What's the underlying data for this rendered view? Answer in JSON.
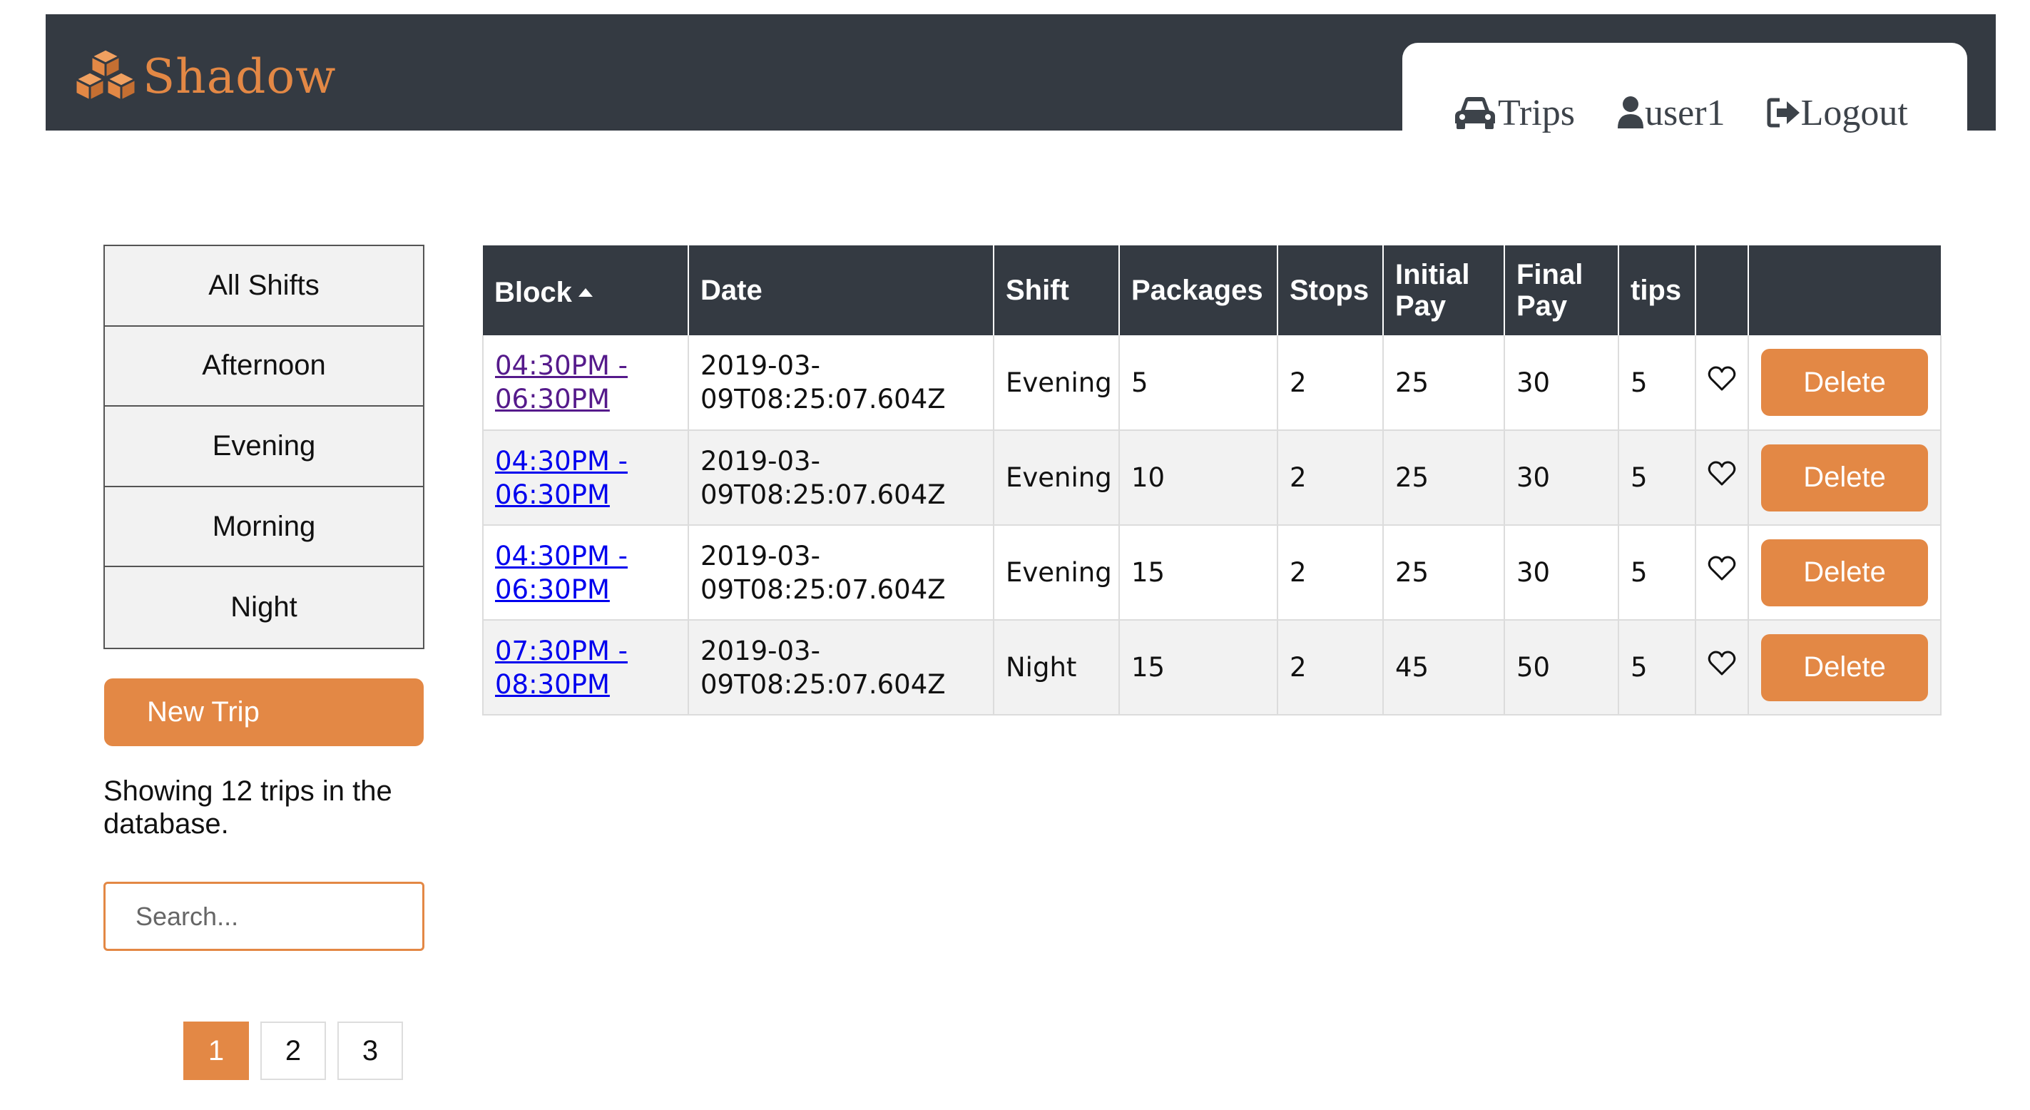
{
  "header": {
    "brand": "Shadow",
    "nav": [
      {
        "label": "Trips",
        "icon": "car-icon"
      },
      {
        "label": "user1",
        "icon": "user-icon"
      },
      {
        "label": "Logout",
        "icon": "logout-icon"
      }
    ]
  },
  "sidebar": {
    "shifts": [
      "All Shifts",
      "Afternoon",
      "Evening",
      "Morning",
      "Night"
    ],
    "new_trip_label": "New Trip",
    "showing_text": "Showing 12 trips in the database.",
    "search_placeholder": "Search...",
    "pages": [
      "1",
      "2",
      "3"
    ],
    "active_page": "1"
  },
  "table": {
    "columns": [
      "Block",
      "Date",
      "Shift",
      "Packages",
      "Stops",
      "Initial Pay",
      "Final Pay",
      "tips",
      "",
      ""
    ],
    "sort_column": "Block",
    "sort_direction": "ascending",
    "delete_label": "Delete",
    "rows": [
      {
        "block": "04:30PM - 06:30PM",
        "visited": true,
        "date": "2019-03-09T08:25:07.604Z",
        "shift": "Evening",
        "packages": "5",
        "stops": "2",
        "initial_pay": "25",
        "final_pay": "30",
        "tips": "5"
      },
      {
        "block": "04:30PM - 06:30PM",
        "visited": false,
        "date": "2019-03-09T08:25:07.604Z",
        "shift": "Evening",
        "packages": "10",
        "stops": "2",
        "initial_pay": "25",
        "final_pay": "30",
        "tips": "5"
      },
      {
        "block": "04:30PM - 06:30PM",
        "visited": false,
        "date": "2019-03-09T08:25:07.604Z",
        "shift": "Evening",
        "packages": "15",
        "stops": "2",
        "initial_pay": "25",
        "final_pay": "30",
        "tips": "5"
      },
      {
        "block": "07:30PM - 08:30PM",
        "visited": false,
        "date": "2019-03-09T08:25:07.604Z",
        "shift": "Night",
        "packages": "15",
        "stops": "2",
        "initial_pay": "45",
        "final_pay": "50",
        "tips": "5"
      }
    ]
  },
  "colors": {
    "accent": "#e38845",
    "header_bg": "#343a42",
    "link": "#0000ee",
    "link_visited": "#551a8b"
  }
}
